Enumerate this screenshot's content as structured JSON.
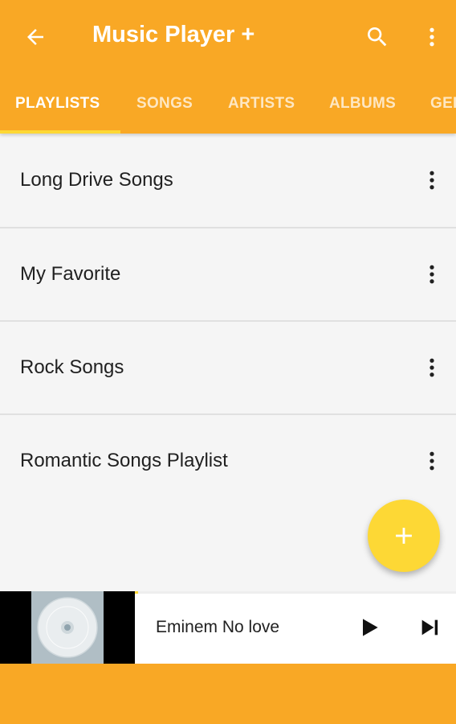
{
  "app": {
    "title": "Music Player +",
    "back_icon": "arrow-back-icon",
    "search_icon": "search-icon",
    "menu_icon": "more-vert-icon",
    "primary_color": "#f9a825",
    "accent_color": "#fdd835"
  },
  "tabs": [
    {
      "label": "PLAYLISTS",
      "active": true
    },
    {
      "label": "SONGS",
      "active": false
    },
    {
      "label": "ARTISTS",
      "active": false
    },
    {
      "label": "ALBUMS",
      "active": false
    },
    {
      "label": "GEI",
      "active": false
    }
  ],
  "playlists": [
    {
      "name": "Long Drive Songs"
    },
    {
      "name": "My Favorite"
    },
    {
      "name": "Rock Songs"
    },
    {
      "name": "Romantic Songs Playlist"
    }
  ],
  "fab": {
    "icon": "add-icon"
  },
  "now_playing": {
    "title": "Eminem No love",
    "album_art_icon": "cd-disc-icon",
    "play_icon": "play-icon",
    "next_icon": "skip-next-icon",
    "progress": 0.01
  }
}
